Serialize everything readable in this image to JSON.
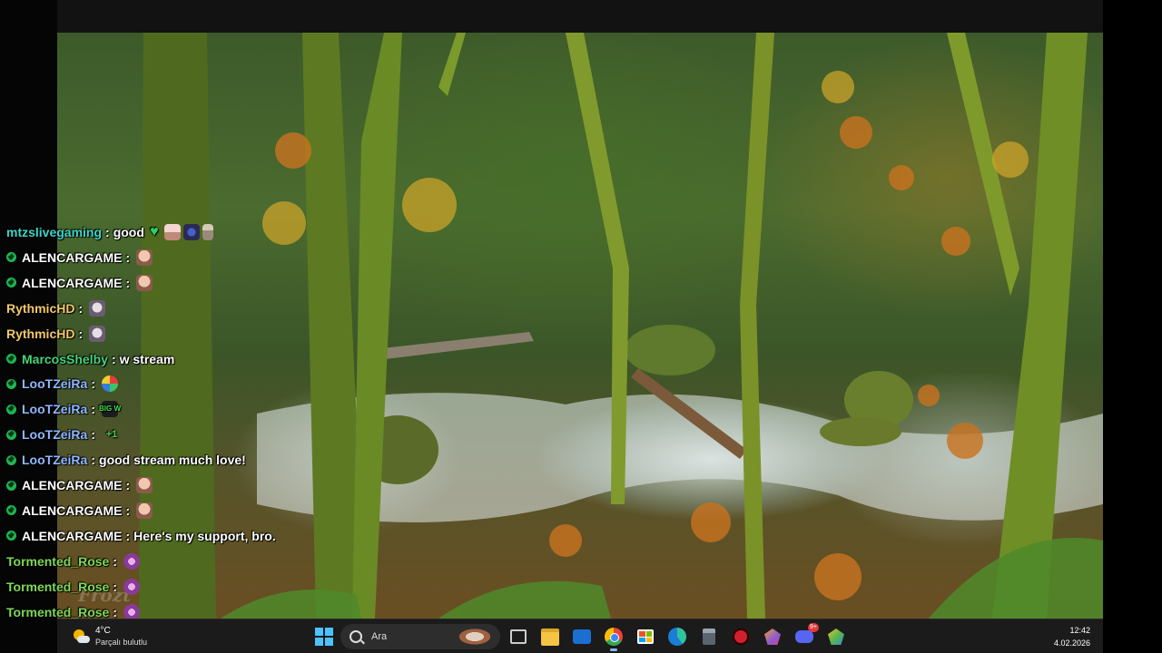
{
  "chat": {
    "messages": [
      {
        "user": "mtzslivegaming",
        "color": "#3dd6c6",
        "badge": false,
        "text": "good",
        "emotes": [
          "heart",
          "anime",
          "butterfly",
          "figure"
        ]
      },
      {
        "user": "ALENCARGAME",
        "color": "#ffffff",
        "badge": true,
        "text": "",
        "emotes": [
          "face"
        ]
      },
      {
        "user": "ALENCARGAME",
        "color": "#ffffff",
        "badge": true,
        "text": "",
        "emotes": [
          "face"
        ]
      },
      {
        "user": "RythmicHD",
        "color": "#f2c96a",
        "badge": false,
        "text": "",
        "emotes": [
          "ghost"
        ]
      },
      {
        "user": "RythmicHD",
        "color": "#f2c96a",
        "badge": false,
        "text": "",
        "emotes": [
          "ghost"
        ]
      },
      {
        "user": "MarcosShelby",
        "color": "#46d37a",
        "badge": true,
        "text": "w stream",
        "emotes": []
      },
      {
        "user": "LooTZeiRa",
        "color": "#8fb8ff",
        "badge": true,
        "text": "",
        "emotes": [
          "globe"
        ]
      },
      {
        "user": "LooTZeiRa",
        "color": "#8fb8ff",
        "badge": true,
        "text": "",
        "emotes": [
          "big"
        ]
      },
      {
        "user": "LooTZeiRa",
        "color": "#8fb8ff",
        "badge": true,
        "text": "",
        "emotes": [
          "plus"
        ]
      },
      {
        "user": "LooTZeiRa",
        "color": "#8fb8ff",
        "badge": true,
        "text": "good stream much love!",
        "emotes": []
      },
      {
        "user": "ALENCARGAME",
        "color": "#ffffff",
        "badge": true,
        "text": "",
        "emotes": [
          "face"
        ]
      },
      {
        "user": "ALENCARGAME",
        "color": "#ffffff",
        "badge": true,
        "text": "",
        "emotes": [
          "face"
        ]
      },
      {
        "user": "ALENCARGAME",
        "color": "#ffffff",
        "badge": true,
        "text": "Here's my support, bro.",
        "emotes": []
      },
      {
        "user": "Tormented_Rose",
        "color": "#7ed957",
        "badge": false,
        "text": "",
        "emotes": [
          "flower"
        ]
      },
      {
        "user": "Tormented_Rose",
        "color": "#7ed957",
        "badge": false,
        "text": "",
        "emotes": [
          "flower"
        ]
      },
      {
        "user": "Tormented_Rose",
        "color": "#7ed957",
        "badge": false,
        "text": "",
        "emotes": [
          "flower"
        ]
      }
    ],
    "separator": ":",
    "big_emote_text": "BIG W",
    "plus_emote_text": "+1"
  },
  "watermark": "Frozt",
  "taskbar": {
    "weather": {
      "temp": "4°C",
      "condition": "Parçalı bulutlu"
    },
    "search_placeholder": "Ara",
    "clock": {
      "time": "12:42",
      "date": "4.02.2026"
    },
    "apps": [
      "task-view",
      "file-explorer",
      "outlook",
      "chrome",
      "microsoft-store",
      "edge",
      "calculator",
      "security-app",
      "obsidian",
      "discord",
      "chrome-dev"
    ],
    "discord_badge": "9+"
  }
}
